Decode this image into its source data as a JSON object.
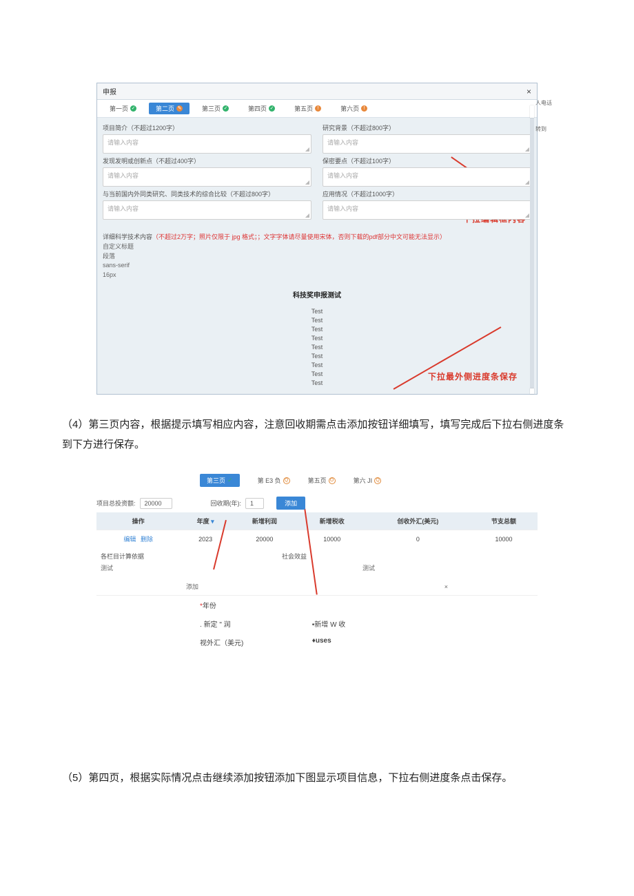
{
  "shot1": {
    "title": "申报",
    "close": "×",
    "tabs": [
      {
        "label": "第一页",
        "status": "ok"
      },
      {
        "label": "第二页",
        "status": "pen",
        "active": true
      },
      {
        "label": "第三页",
        "status": "ok"
      },
      {
        "label": "第四页",
        "status": "ok"
      },
      {
        "label": "第五页",
        "status": "warn"
      },
      {
        "label": "第六页",
        "status": "warn"
      }
    ],
    "left": [
      {
        "lbl": "项目简介（不超过1200字）",
        "ph": "请输入内容"
      },
      {
        "lbl": "发现发明或创新点（不超过400字）",
        "ph": "请输入内容"
      },
      {
        "lbl": "与当前国内外同类研究、同类技术的综合比较（不超过800字）",
        "ph": "请输入内容"
      }
    ],
    "right": [
      {
        "lbl": "研究背景（不超过800字）",
        "ph": "请输入内容"
      },
      {
        "lbl": "保密要点（不超过100字）",
        "ph": "请输入内容"
      },
      {
        "lbl": "应用情况（不超过1000字）",
        "ph": "请输入内容"
      }
    ],
    "rich_lbl_plain": "详细科学技术内容",
    "rich_lbl_red": "（不超过2万字；照片仅限于 jpg 格式；；文字字体请尽量使用宋体，否则下载的pdf部分中文可能无法显示）",
    "tool_lines": [
      "自定义标题",
      "段落",
      "sans-serif",
      "16px"
    ],
    "rich_title": "科技奖申报测试",
    "tests": [
      "Test",
      "Test",
      "Test",
      "Test",
      "Test",
      "Test",
      "Test",
      "Test",
      "Test"
    ],
    "ann1": "下拉编辑框内容",
    "ann2": "下拉最外侧进度条保存",
    "side": [
      "人电话",
      "转到"
    ]
  },
  "para1": "（4）第三页内容，根据提示填写相应内容，注意回收期需点击添加按钮详细填写，填写完成后下拉右侧进度条到下方进行保存。",
  "shot2": {
    "tabs": [
      {
        "label": "第三页",
        "active": true
      },
      {
        "label": "第 E3 负",
        "mark": "Q"
      },
      {
        "label": "第五页",
        "mark": "O"
      },
      {
        "label": "第六 JI",
        "mark": "Q"
      }
    ],
    "proj_inv_lbl": "项目总投资额:",
    "proj_inv_val": "20000",
    "payback_lbl": "回收期(年):",
    "payback_val": "1",
    "add_btn": "添加",
    "th": [
      "操作",
      "年度",
      "新增利润",
      "新增税收",
      "创收外汇(美元)",
      "节支总额"
    ],
    "row": {
      "ops_edit": "编辑",
      "ops_del": "删除",
      "year": "2023",
      "profit": "20000",
      "tax": "10000",
      "fx": "0",
      "save": "10000"
    },
    "sec_lbls": [
      "各栏目计算依据",
      "社会效益"
    ],
    "sec_vals": [
      "测试",
      "测试"
    ],
    "dlg_add": "添加",
    "dlg_close": "×",
    "dlg_fields": {
      "year": "年份",
      "profit": "新定 \" 润",
      "tax": "新增 W 收",
      "fx": "视外汇（美元)",
      "uses": "uses"
    },
    "req": "*",
    "dot": "."
  },
  "para2": "（5）第四页，根据实际情况点击继续添加按钮添加下图显示项目信息，下拉右侧进度条点击保存。"
}
